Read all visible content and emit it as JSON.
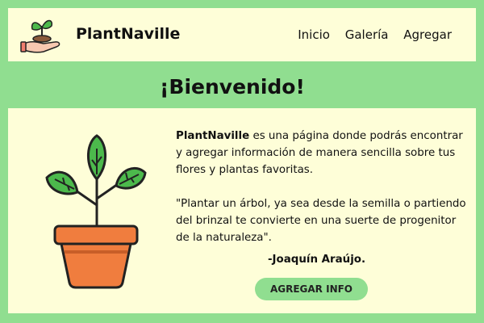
{
  "header": {
    "brand": "PlantNaville",
    "nav": [
      "Inicio",
      "Galería",
      "Agregar"
    ]
  },
  "banner": {
    "title": "¡Bienvenido!"
  },
  "content": {
    "intro_brand": "PlantNaville",
    "intro_rest": " es una página donde podrás encontrar y agregar información de manera sencilla sobre tus flores y plantas favoritas.",
    "quote": "\"Plantar un árbol, ya sea desde la semilla o partiendo del brinzal te convierte en una suerte de progenitor de la naturaleza\".",
    "author": "-Joaquín Araújo.",
    "button": "AGREGAR INFO"
  },
  "colors": {
    "background_green": "#90de90",
    "panel_cream": "#fefed8",
    "pot_orange": "#f07d3e",
    "leaf_green": "#4cb94c"
  }
}
